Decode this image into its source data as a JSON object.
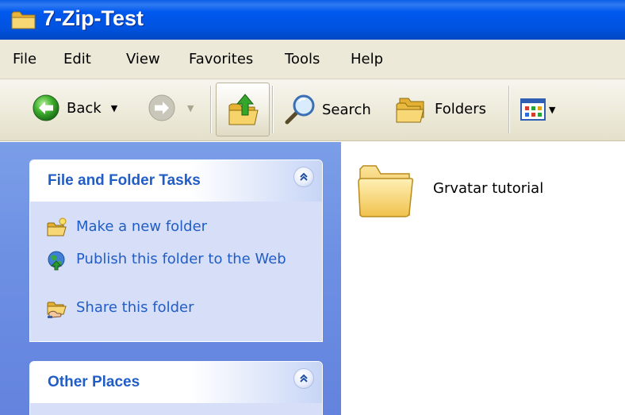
{
  "window": {
    "title": "7-Zip-Test",
    "icon": "folder-icon"
  },
  "menu": {
    "items": [
      "File",
      "Edit",
      "View",
      "Favorites",
      "Tools",
      "Help"
    ]
  },
  "toolbar": {
    "back_label": "Back",
    "search_label": "Search",
    "folders_label": "Folders",
    "icons": [
      "back-arrow-icon",
      "forward-arrow-icon",
      "up-folder-icon",
      "search-magnifier-icon",
      "folders-icon",
      "views-icon"
    ]
  },
  "task_pane": {
    "file_tasks": {
      "title": "File and Folder Tasks",
      "items": [
        {
          "label": "Make a new folder",
          "icon": "new-folder-icon"
        },
        {
          "label": "Publish this folder to the Web",
          "icon": "publish-web-icon"
        },
        {
          "label": "Share this folder",
          "icon": "share-folder-icon"
        }
      ]
    },
    "other_places": {
      "title": "Other Places"
    }
  },
  "files": [
    {
      "name": "Grvatar tutorial",
      "type": "folder"
    }
  ],
  "colors": {
    "titlebar": "#0053e0",
    "task_pane_bg": "#6d8fe3",
    "panel_title": "#215dc6",
    "panel_body": "#d6dff7",
    "toolbar_bg": "#ece9d8"
  }
}
